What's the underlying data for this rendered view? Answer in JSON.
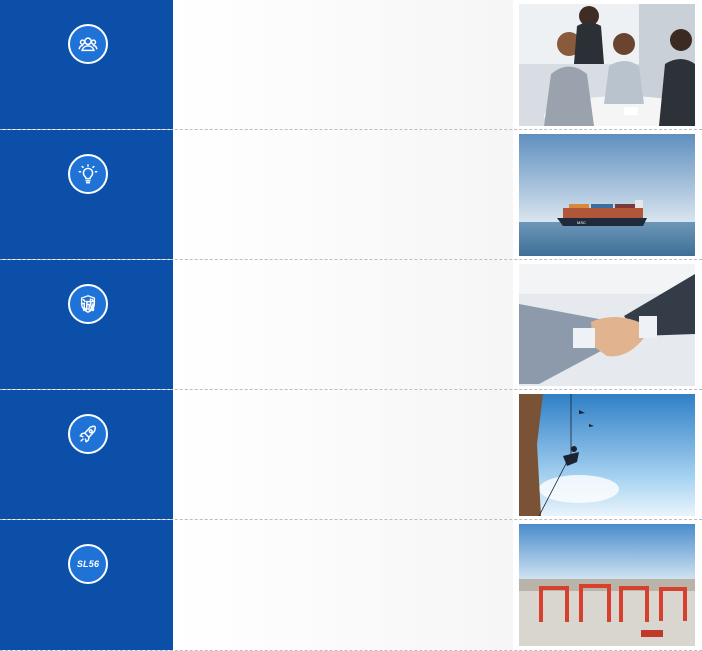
{
  "rows": [
    {
      "icon": "team-icon",
      "photo": "business-meeting-photo"
    },
    {
      "icon": "lightbulb-icon",
      "photo": "container-ship-photo"
    },
    {
      "icon": "integrity-badge-icon",
      "badge_text": "诚",
      "photo": "handshake-photo"
    },
    {
      "icon": "rocket-icon",
      "photo": "rock-climber-photo"
    },
    {
      "icon": "sl56-logo-icon",
      "badge_text": "SL56",
      "photo": "port-cranes-photo"
    }
  ],
  "colors": {
    "sidebar": "#0b4fa8",
    "badge": "#1f73d6",
    "divider": "#b9bdc4"
  }
}
